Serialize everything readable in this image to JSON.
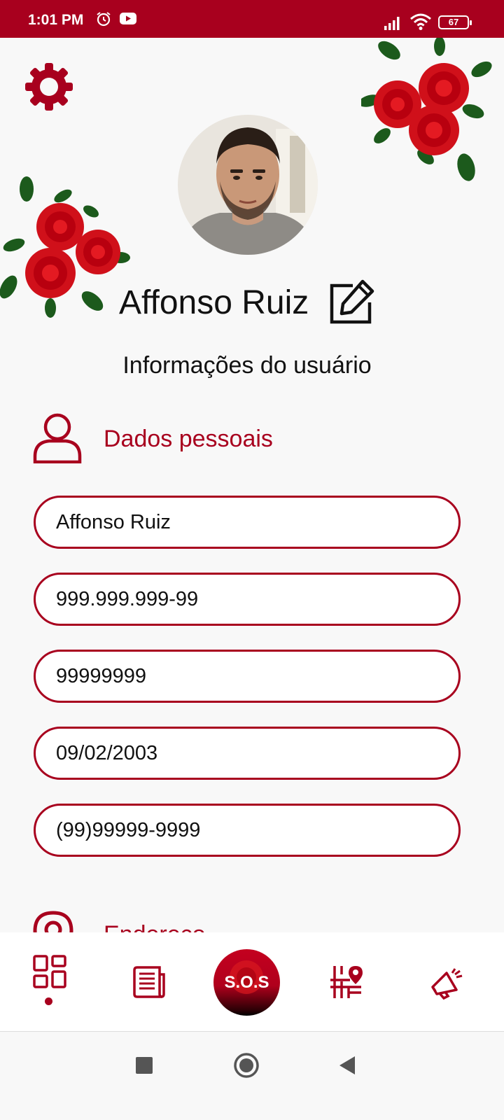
{
  "status_bar": {
    "time": "1:01 PM",
    "battery": "67",
    "icons": [
      "alarm-icon",
      "youtube-icon",
      "signal-icon",
      "wifi-icon",
      "battery-icon"
    ]
  },
  "profile": {
    "name": "Affonso Ruiz",
    "section_title": "Informações do usuário"
  },
  "personal": {
    "title": "Dados pessoais",
    "fields": {
      "name": "Affonso Ruiz",
      "cpf": "999.999.999-99",
      "rg": "99999999",
      "birth_date": "09/02/2003",
      "phone": "(99)99999-9999"
    }
  },
  "address": {
    "title": "Endereço"
  },
  "bottom_nav": {
    "items": [
      "dashboard-icon",
      "news-icon",
      "sos-button",
      "map-route-icon",
      "megaphone-icon"
    ],
    "sos_label": "S.O.S"
  },
  "theme": {
    "accent": "#a8001e",
    "background": "#f8f8f8"
  }
}
